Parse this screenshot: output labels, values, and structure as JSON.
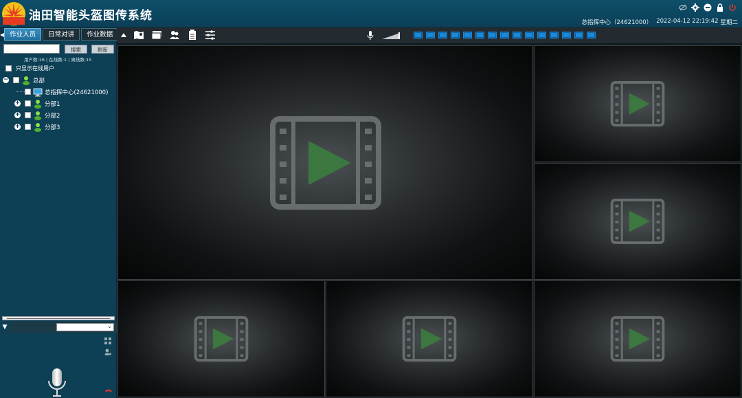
{
  "header": {
    "title": "油田智能头盔图传系统",
    "user_info": "总指挥中心（24621000）",
    "datetime": "2022-04-12 22:19:42",
    "weekday": "星期二"
  },
  "sidebar": {
    "tabs": [
      {
        "label": "作业人员",
        "active": true
      },
      {
        "label": "日常对讲",
        "active": false
      },
      {
        "label": "作业数据",
        "active": false
      }
    ],
    "search_button": "搜索",
    "refresh_button": "刷新",
    "counts": "用户数:16 | 在线数:1 | 离线数:15",
    "online_only_label": "只显示在线用户",
    "tree": {
      "root": "总部",
      "items": [
        {
          "label": "总指挥中心(24621000)",
          "type": "center"
        },
        {
          "label": "分部1",
          "type": "group"
        },
        {
          "label": "分部2",
          "type": "group"
        },
        {
          "label": "分部3",
          "type": "group"
        }
      ]
    }
  },
  "colors": {
    "header_bg": "#0e4f6a",
    "sidebar_bg": "#0d3f55",
    "tab_active": "#2f86b8",
    "layout_button": "#1a88d8",
    "play_green": "#3b7d3f",
    "power_red": "#e03a2e"
  },
  "icons": {
    "header": [
      "eye-off-icon",
      "gear-icon",
      "minus-circle-icon",
      "lock-icon",
      "power-icon"
    ],
    "toolbar": [
      "collapse-arrow-icon",
      "map-icon",
      "folder-icon",
      "users-icon",
      "document-icon",
      "settings-sliders-icon"
    ],
    "audio": [
      "microphone-icon",
      "volume-icon"
    ]
  }
}
